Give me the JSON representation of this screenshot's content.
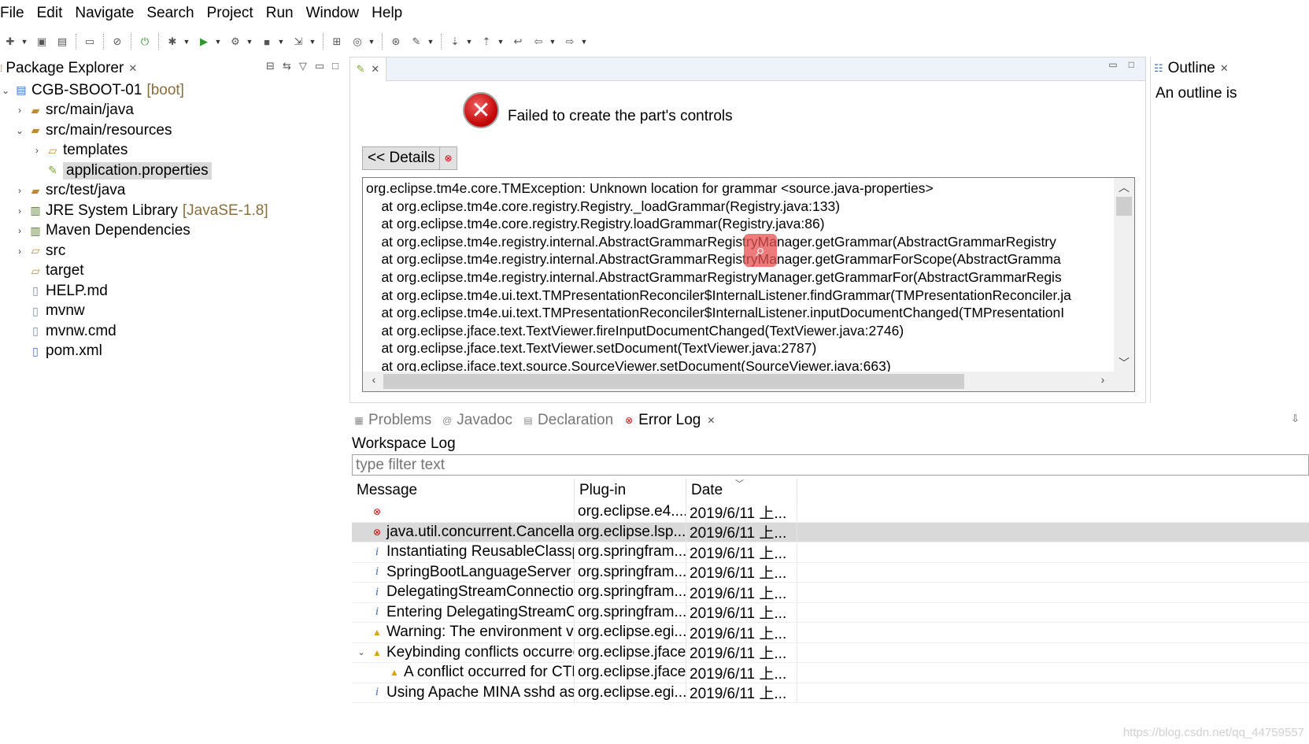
{
  "menu": [
    "File",
    "Edit",
    "Navigate",
    "Search",
    "Project",
    "Run",
    "Window",
    "Help"
  ],
  "package_explorer": {
    "title": "Package Explorer",
    "items": [
      {
        "label": "CGB-SBOOT-01",
        "decoration": "[boot]",
        "icon": "project-icon",
        "indent": 0,
        "twisty": "⌄"
      },
      {
        "label": "src/main/java",
        "decoration": "",
        "icon": "source-folder-icon",
        "indent": 1,
        "twisty": "›"
      },
      {
        "label": "src/main/resources",
        "decoration": "",
        "icon": "source-folder-icon",
        "indent": 1,
        "twisty": "⌄"
      },
      {
        "label": "templates",
        "decoration": "",
        "icon": "folder-icon",
        "indent": 2,
        "twisty": "›"
      },
      {
        "label": "application.properties",
        "decoration": "",
        "icon": "properties-file-icon",
        "indent": 2,
        "twisty": "",
        "selected": true
      },
      {
        "label": "src/test/java",
        "decoration": "",
        "icon": "source-folder-icon",
        "indent": 1,
        "twisty": "›"
      },
      {
        "label": "JRE System Library",
        "decoration": "[JavaSE-1.8]",
        "icon": "library-icon",
        "indent": 1,
        "twisty": "›"
      },
      {
        "label": "Maven Dependencies",
        "decoration": "",
        "icon": "library-icon",
        "indent": 1,
        "twisty": "›"
      },
      {
        "label": "src",
        "decoration": "",
        "icon": "folder-icon",
        "indent": 1,
        "twisty": "›"
      },
      {
        "label": "target",
        "decoration": "",
        "icon": "folder-icon",
        "indent": 1,
        "twisty": ""
      },
      {
        "label": "HELP.md",
        "decoration": "",
        "icon": "file-icon",
        "indent": 1,
        "twisty": ""
      },
      {
        "label": "mvnw",
        "decoration": "",
        "icon": "file-icon",
        "indent": 1,
        "twisty": ""
      },
      {
        "label": "mvnw.cmd",
        "decoration": "",
        "icon": "file-icon",
        "indent": 1,
        "twisty": ""
      },
      {
        "label": "pom.xml",
        "decoration": "",
        "icon": "xml-file-icon",
        "indent": 1,
        "twisty": ""
      }
    ]
  },
  "editor": {
    "error_message": "Failed to create the part's controls",
    "details_button": "<< Details",
    "stack_trace": [
      "org.eclipse.tm4e.core.TMException: Unknown location for grammar <source.java-properties>",
      "\tat org.eclipse.tm4e.core.registry.Registry._loadGrammar(Registry.java:133)",
      "\tat org.eclipse.tm4e.core.registry.Registry.loadGrammar(Registry.java:86)",
      "\tat org.eclipse.tm4e.registry.internal.AbstractGrammarRegistryManager.getGrammar(AbstractGrammarRegistry",
      "\tat org.eclipse.tm4e.registry.internal.AbstractGrammarRegistryManager.getGrammarForScope(AbstractGramma",
      "\tat org.eclipse.tm4e.registry.internal.AbstractGrammarRegistryManager.getGrammarFor(AbstractGrammarRegis",
      "\tat org.eclipse.tm4e.ui.text.TMPresentationReconciler$InternalListener.findGrammar(TMPresentationReconciler.ja",
      "\tat org.eclipse.tm4e.ui.text.TMPresentationReconciler$InternalListener.inputDocumentChanged(TMPresentationI",
      "\tat org.eclipse.jface.text.TextViewer.fireInputDocumentChanged(TextViewer.java:2746)",
      "\tat org.eclipse.jface.text.TextViewer.setDocument(TextViewer.java:2787)",
      "\tat org.eclipse.iface.text.source.SourceViewer.setDocument(SourceViewer.iava:663)"
    ]
  },
  "outline": {
    "title": "Outline",
    "message": "An outline is"
  },
  "bottom_tabs": [
    {
      "label": "Problems",
      "icon": "problems-icon",
      "active": false
    },
    {
      "label": "Javadoc",
      "icon": "javadoc-icon",
      "active": false
    },
    {
      "label": "Declaration",
      "icon": "declaration-icon",
      "active": false
    },
    {
      "label": "Error Log",
      "icon": "error-log-icon",
      "active": true
    }
  ],
  "error_log": {
    "heading": "Workspace Log",
    "filter_placeholder": "type filter text",
    "columns": [
      "Message",
      "Plug-in",
      "Date"
    ],
    "rows": [
      {
        "severity": "error",
        "message": "",
        "plugin": "org.eclipse.e4....",
        "date": "2019/6/11 上...",
        "expand": "",
        "indent": 1
      },
      {
        "severity": "error",
        "message": "java.util.concurrent.Cancellati",
        "plugin": "org.eclipse.lsp...",
        "date": "2019/6/11 上...",
        "expand": "",
        "indent": 1,
        "selected": true
      },
      {
        "severity": "info",
        "message": "Instantiating ReusableClasspa",
        "plugin": "org.springfram...",
        "date": "2019/6/11 上...",
        "expand": "",
        "indent": 1
      },
      {
        "severity": "info",
        "message": "SpringBootLanguageServer e",
        "plugin": "org.springfram...",
        "date": "2019/6/11 上...",
        "expand": "",
        "indent": 1
      },
      {
        "severity": "info",
        "message": "DelegatingStreamConnectior",
        "plugin": "org.springfram...",
        "date": "2019/6/11 上...",
        "expand": "",
        "indent": 1
      },
      {
        "severity": "info",
        "message": "Entering DelegatingStreamCc",
        "plugin": "org.springfram...",
        "date": "2019/6/11 上...",
        "expand": "",
        "indent": 1
      },
      {
        "severity": "warning",
        "message": "Warning: The environment va",
        "plugin": "org.eclipse.egi...",
        "date": "2019/6/11 上...",
        "expand": "",
        "indent": 1
      },
      {
        "severity": "warning",
        "message": "Keybinding conflicts occurrec",
        "plugin": "org.eclipse.jface",
        "date": "2019/6/11 上...",
        "expand": "⌄",
        "indent": 1
      },
      {
        "severity": "warning",
        "message": "A conflict occurred for CTR",
        "plugin": "org.eclipse.jface",
        "date": "2019/6/11 上...",
        "expand": "",
        "indent": 2
      },
      {
        "severity": "info",
        "message": "Using Apache MINA sshd as s",
        "plugin": "org.eclipse.egi...",
        "date": "2019/6/11 上...",
        "expand": "",
        "indent": 1
      }
    ]
  },
  "watermark": "https://blog.csdn.net/qq_44759557"
}
